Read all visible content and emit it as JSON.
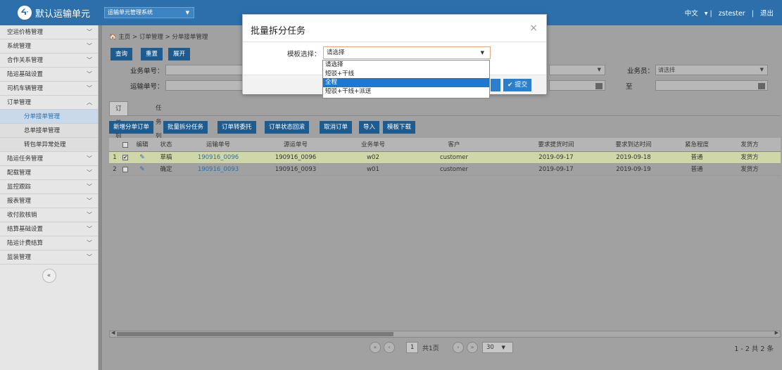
{
  "topbar": {
    "logo_text": "ᔰ",
    "app_title": "默认运输单元",
    "system_select": "运输单元管理系统",
    "language": "中文",
    "separator1": "▾ |",
    "user": "zstester",
    "separator2": "|",
    "logout": "退出",
    "colors": {
      "bar": "#2c6faa"
    }
  },
  "sidebar": {
    "items_top": [
      {
        "label": "空运价格管理"
      },
      {
        "label": "系统管理"
      },
      {
        "label": "合作关系管理"
      },
      {
        "label": "陆运基础设置"
      },
      {
        "label": "司机车辆管理"
      },
      {
        "label": "订单管理"
      }
    ],
    "sub_items": [
      {
        "label": "分单接单管理"
      },
      {
        "label": "总单接单管理"
      },
      {
        "label": "转包单异常处理"
      }
    ],
    "items_bottom": [
      {
        "label": "陆运任务管理"
      },
      {
        "label": "配载管理"
      },
      {
        "label": "监控跟踪"
      },
      {
        "label": "报表管理"
      },
      {
        "label": "收付款核销"
      },
      {
        "label": "结算基础设置"
      },
      {
        "label": "陆运计费结算"
      },
      {
        "label": "监装管理"
      }
    ],
    "chevron": "﹀",
    "collapse": "«"
  },
  "breadcrumb": {
    "home_icon": "🏠",
    "home": "主页",
    "sep": ">",
    "level1": "订单管理",
    "level2": "分单接单管理"
  },
  "toolbar": {
    "query": "查询",
    "reset": "重置",
    "expand": "展开"
  },
  "filters": {
    "business_no_label": "业务单号：",
    "transport_no_label": "运输单号：",
    "salesman_label": "业务员：",
    "salesman_value": "请选择",
    "to_label": "至"
  },
  "tabs": {
    "order_list": "订单列表",
    "task_list": "任务列表"
  },
  "actions": [
    "新增分单订单",
    "批量拆分任务",
    "订单转委托",
    "订单状态回滚",
    "取消订单",
    "导入",
    "模板下载"
  ],
  "grid": {
    "headers": [
      "编辑",
      "状态",
      "运输单号",
      "源运单号",
      "业务单号",
      "客户",
      "要求提货时间",
      "要求到达时间",
      "紧急程度",
      "发货方"
    ],
    "rows": [
      {
        "idx": "1",
        "checked": "✔",
        "status": "草稿",
        "transport_no": "190916_0096",
        "source_no": "190916_0096",
        "business_no": "w02",
        "customer": "customer",
        "pickup": "2019-09-17",
        "arrive": "2019-09-18",
        "urgency": "普通",
        "shipper": "发货方"
      },
      {
        "idx": "2",
        "checked": "",
        "status": "确定",
        "transport_no": "190916_0093",
        "source_no": "190916_0093",
        "business_no": "w01",
        "customer": "customer",
        "pickup": "2019-09-17",
        "arrive": "2019-09-19",
        "urgency": "普通",
        "shipper": "发货方"
      }
    ]
  },
  "pager": {
    "first": "«",
    "prev": "‹",
    "page": "1",
    "of_text": "共1页",
    "next": "›",
    "last": "»",
    "page_size": "30",
    "count": "1 - 2  共 2 条"
  },
  "modal": {
    "title": "批量拆分任务",
    "close": "×",
    "template_label": "模板选择：",
    "template_value": "请选择",
    "submit": "✔ 提交",
    "options": [
      "请选择",
      "短驳+干线",
      "全程",
      "短驳+干线+派送"
    ],
    "highlighted_option": 2
  }
}
